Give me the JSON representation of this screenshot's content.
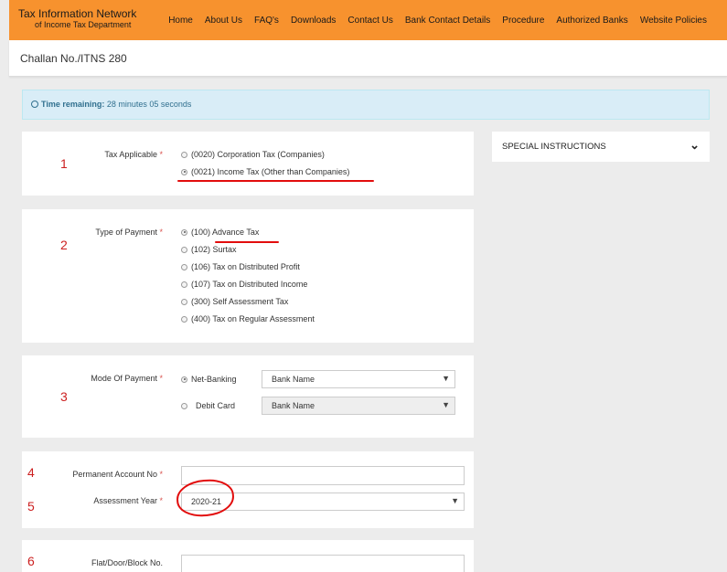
{
  "header": {
    "brand_title": "Tax Information Network",
    "brand_subtitle": "of Income Tax Department",
    "nav": [
      "Home",
      "About Us",
      "FAQ's",
      "Downloads",
      "Contact Us",
      "Bank Contact Details",
      "Procedure",
      "Authorized Banks",
      "Website Policies"
    ]
  },
  "page_title": "Challan No./ITNS 280",
  "timer": {
    "label": "Time remaining:",
    "value": "28 minutes 05 seconds"
  },
  "tax_applicable": {
    "label": "Tax Applicable",
    "required": "*",
    "marker": "1",
    "options": [
      "(0020) Corporation Tax (Companies)",
      "(0021) Income Tax (Other than Companies)"
    ],
    "selected_index": 1
  },
  "type_of_payment": {
    "label": "Type of Payment",
    "required": "*",
    "marker": "2",
    "options": [
      "(100) Advance Tax",
      "(102) Surtax",
      "(106) Tax on Distributed Profit",
      "(107) Tax on Distributed Income",
      "(300) Self Assessment Tax",
      "(400) Tax on Regular Assessment"
    ],
    "selected_index": 0
  },
  "mode_of_payment": {
    "label": "Mode Of Payment",
    "required": "*",
    "marker": "3",
    "options": [
      {
        "label": "Net-Banking",
        "bank_placeholder": "Bank Name"
      },
      {
        "label": "Debit Card",
        "bank_placeholder": "Bank Name"
      }
    ],
    "selected_index": 0
  },
  "pan": {
    "label": "Permanent Account No",
    "required": "*",
    "marker": "4",
    "value": ""
  },
  "assessment_year": {
    "label": "Assessment Year",
    "required": "*",
    "marker": "5",
    "value": "2020-21"
  },
  "flat": {
    "label": "Flat/Door/Block No.",
    "marker": "6",
    "value": ""
  },
  "side_panel": {
    "title": "SPECIAL INSTRUCTIONS"
  },
  "colors": {
    "header": "#f7922e",
    "annotation": "#e20d0d",
    "timer_bg": "#d9edf7"
  }
}
